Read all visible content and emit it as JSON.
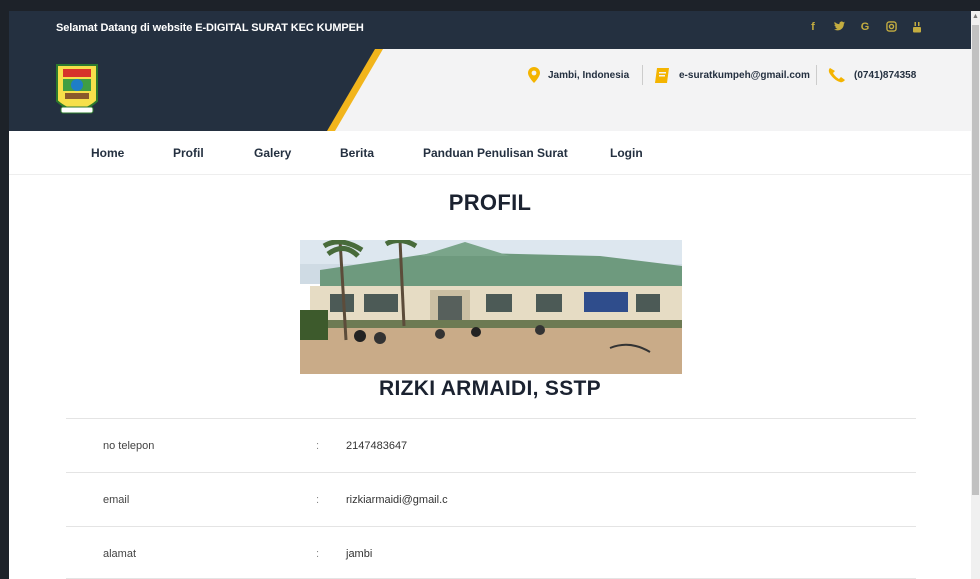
{
  "topbar": {
    "welcome": "Selamat Datang di website E-DIGITAL SURAT KEC KUMPEH",
    "social": [
      "f",
      "y",
      "G",
      "o",
      "y"
    ]
  },
  "header": {
    "location": "Jambi, Indonesia",
    "email": "e-suratkumpeh@gmail.com",
    "phone": "(0741)874358"
  },
  "nav": [
    "Home",
    "Profil",
    "Galery",
    "Berita",
    "Panduan Penulisan Surat",
    "Login"
  ],
  "profile": {
    "title": "PROFIL",
    "name": "RIZKI ARMAIDI, SSTP",
    "rows": [
      {
        "label": "no telepon",
        "colon": ":",
        "value": "2147483647"
      },
      {
        "label": "email",
        "colon": ":",
        "value": "rizkiarmaidi@gmail.c"
      },
      {
        "label": "alamat",
        "colon": ":",
        "value": "jambi"
      }
    ]
  },
  "colors": {
    "navy": "#243040",
    "gold": "#f4b400",
    "accent_stripe": "#f2b51c"
  }
}
